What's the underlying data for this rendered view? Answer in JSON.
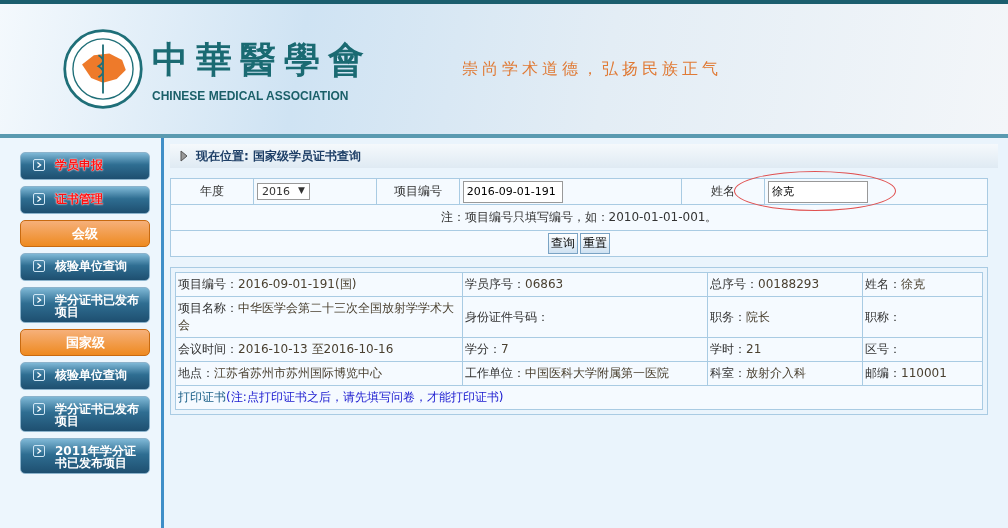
{
  "header": {
    "title": "中華醫學會",
    "subtitle": "CHINESE MEDICAL ASSOCIATION",
    "slogan": "崇尚学术道德，弘扬民族正气"
  },
  "sidebar": {
    "items": [
      {
        "kind": "link",
        "label": "学员申报",
        "alert": true
      },
      {
        "kind": "link",
        "label": "证书管理",
        "alert": true
      },
      {
        "kind": "section",
        "label": "会级"
      },
      {
        "kind": "link",
        "label": "核验单位查询",
        "alert": false
      },
      {
        "kind": "link",
        "label": "学分证书已发布项目",
        "alert": false
      },
      {
        "kind": "section",
        "label": "国家级"
      },
      {
        "kind": "link",
        "label": "核验单位查询",
        "alert": false
      },
      {
        "kind": "link",
        "label": "学分证书已发布项目",
        "alert": false
      },
      {
        "kind": "link",
        "label": "2011年学分证书已发布项目",
        "alert": false
      }
    ]
  },
  "breadcrumb": "现在位置: 国家级学员证书查询",
  "search": {
    "fields": [
      {
        "kind": "select",
        "label": "年度",
        "value": "2016",
        "caret": "▼",
        "circled": false
      },
      {
        "kind": "input",
        "label": "项目编号",
        "value": "2016-09-01-191",
        "circled": false
      },
      {
        "kind": "input",
        "label": "姓名",
        "value": "徐克",
        "circled": true
      }
    ],
    "note": "注：项目编号只填写编号，如：2010-01-01-001。",
    "buttons": [
      "查询",
      "重置"
    ]
  },
  "result": {
    "rows": [
      [
        {
          "label": "项目编号：",
          "value": "2016-09-01-191(国)"
        },
        {
          "label": "学员序号：",
          "value": "06863"
        },
        {
          "label": "总序号：",
          "value": "00188293"
        },
        {
          "label": "姓名：",
          "value": "徐克"
        }
      ],
      [
        {
          "label": "项目名称：",
          "value": "中华医学会第二十三次全国放射学学术大会"
        },
        {
          "label": "身份证件号码："
        },
        {
          "label": "职务：",
          "value": "院长"
        },
        {
          "label": "职称："
        }
      ],
      [
        {
          "label": "会议时间：",
          "value": "2016-10-13 至2016-10-16"
        },
        {
          "label": "学分：",
          "value": "7"
        },
        {
          "label": "学时：",
          "value": "21"
        },
        {
          "label": "区号："
        }
      ],
      [
        {
          "label": "地点：",
          "value": "江苏省苏州市苏州国际博览中心"
        },
        {
          "label": "工作单位：",
          "value": "中国医科大学附属第一医院"
        },
        {
          "label": "科室：",
          "value": "放射介入科"
        },
        {
          "label": "邮编：",
          "value": "110001"
        }
      ]
    ],
    "print_link": "打印证书",
    "print_note": "(注:点打印证书之后，请先填写问卷，才能打印证书)"
  }
}
